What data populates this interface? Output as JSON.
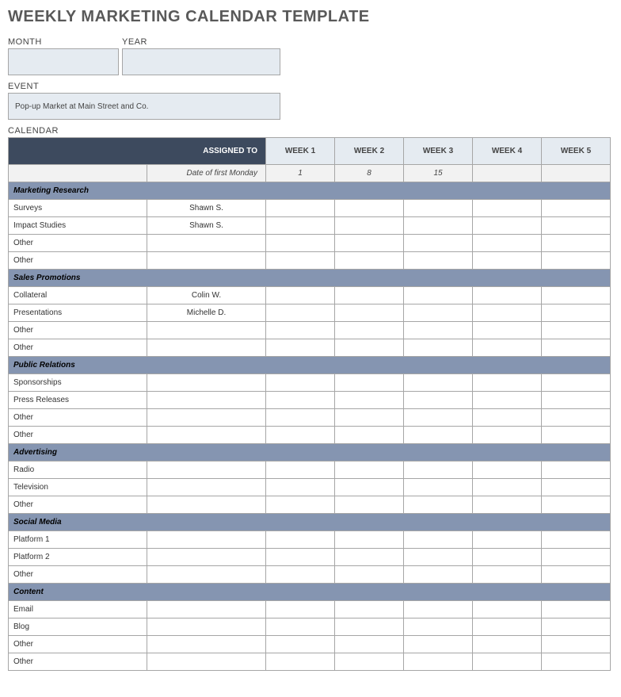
{
  "title": "WEEKLY MARKETING CALENDAR TEMPLATE",
  "fields": {
    "month_label": "MONTH",
    "month_value": "",
    "year_label": "YEAR",
    "year_value": "",
    "event_label": "EVENT",
    "event_value": "Pop-up Market at Main Street and Co."
  },
  "calendar_label": "CALENDAR",
  "headers": {
    "assigned_to": "ASSIGNED TO",
    "weeks": [
      "WEEK 1",
      "WEEK 2",
      "WEEK 3",
      "WEEK 4",
      "WEEK 5"
    ],
    "date_label": "Date of first Monday",
    "dates": [
      "1",
      "8",
      "15",
      "",
      ""
    ]
  },
  "sections": [
    {
      "name": "Marketing Research",
      "rows": [
        {
          "task": "Surveys",
          "assigned": "Shawn S."
        },
        {
          "task": "Impact Studies",
          "assigned": "Shawn S."
        },
        {
          "task": "Other",
          "assigned": ""
        },
        {
          "task": "Other",
          "assigned": ""
        }
      ]
    },
    {
      "name": "Sales Promotions",
      "rows": [
        {
          "task": "Collateral",
          "assigned": "Colin W."
        },
        {
          "task": "Presentations",
          "assigned": "Michelle D."
        },
        {
          "task": "Other",
          "assigned": ""
        },
        {
          "task": "Other",
          "assigned": ""
        }
      ]
    },
    {
      "name": "Public Relations",
      "rows": [
        {
          "task": "Sponsorships",
          "assigned": ""
        },
        {
          "task": "Press Releases",
          "assigned": ""
        },
        {
          "task": "Other",
          "assigned": ""
        },
        {
          "task": "Other",
          "assigned": ""
        }
      ]
    },
    {
      "name": "Advertising",
      "rows": [
        {
          "task": "Radio",
          "assigned": ""
        },
        {
          "task": "Television",
          "assigned": ""
        },
        {
          "task": "Other",
          "assigned": ""
        }
      ]
    },
    {
      "name": "Social Media",
      "rows": [
        {
          "task": "Platform 1",
          "assigned": ""
        },
        {
          "task": "Platform 2",
          "assigned": ""
        },
        {
          "task": "Other",
          "assigned": ""
        }
      ]
    },
    {
      "name": "Content",
      "rows": [
        {
          "task": "Email",
          "assigned": ""
        },
        {
          "task": "Blog",
          "assigned": ""
        },
        {
          "task": "Other",
          "assigned": ""
        },
        {
          "task": "Other",
          "assigned": ""
        }
      ]
    }
  ]
}
